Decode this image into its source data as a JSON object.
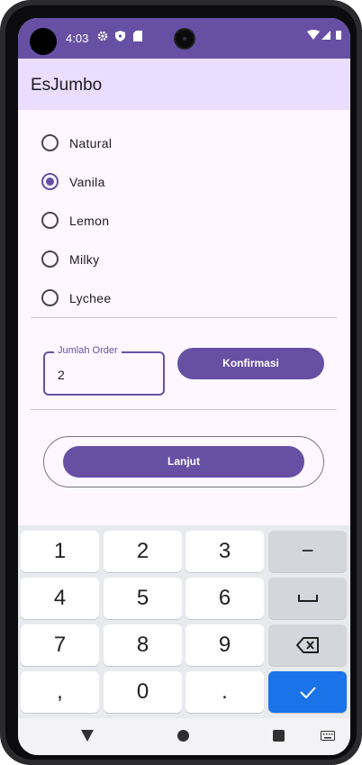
{
  "status_bar": {
    "time": "4:03",
    "icons": [
      "gear-icon",
      "shield-icon",
      "sd-card-icon",
      "wifi-icon",
      "signal-icon",
      "battery-icon"
    ]
  },
  "app_bar": {
    "title": "EsJumbo"
  },
  "flavors": [
    {
      "label": "Natural",
      "checked": false
    },
    {
      "label": "Vanila",
      "checked": true
    },
    {
      "label": "Lemon",
      "checked": false
    },
    {
      "label": "Milky",
      "checked": false
    },
    {
      "label": "Lychee",
      "checked": false
    }
  ],
  "order_field": {
    "label": "Jumlah Order",
    "value": "2"
  },
  "buttons": {
    "confirm_label": "Konfirmasi",
    "next_label": "Lanjut"
  },
  "keyboard": {
    "row1": [
      "1",
      "2",
      "3",
      "−"
    ],
    "row2": [
      "4",
      "5",
      "6",
      "space-icon"
    ],
    "row3": [
      "7",
      "8",
      "9",
      "backspace-icon"
    ],
    "row4": [
      ",",
      "0",
      ".",
      "check-icon"
    ]
  },
  "colors": {
    "primary": "#6750a4",
    "app_bar_bg": "#eaddff",
    "surface": "#fef7ff",
    "keyboard_enter": "#1a73e8"
  }
}
